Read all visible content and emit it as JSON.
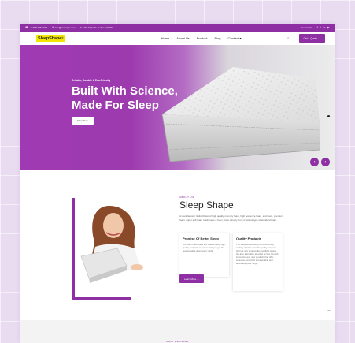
{
  "topbar": {
    "phone": "+1 008 456 0012",
    "email": "info@example.com",
    "address": "4297 Elgin St. Celina, 10299",
    "follow_label": "Follow Us"
  },
  "nav": {
    "logo": "SleepShape",
    "logo_mark": "®",
    "items": [
      "Home",
      "About Us",
      "Product",
      "Blog",
      "Contact"
    ],
    "cta": "Get A Quote"
  },
  "hero": {
    "kicker": "Reliable, Durable & Eco-Friendly",
    "title_line1": "Built With Science,",
    "title_line2": "Made For Sleep",
    "button": "Shop Now"
  },
  "about": {
    "label": "ABOUT US",
    "title": "Sleep Shape",
    "description": "A manufacturer & distributor of high quality memory foam, high resilience foam, and foam, premium foam, super soft foam mattresses & foam, foam directly from it various type of standard foam.",
    "card1_title": "Promise Of Better Sleep",
    "card1_text": "Our foam mattresses are crafted using high quality materials to ensure that you get the best possible sleep every night.",
    "card2_title": "Quality Products",
    "card2_text": "The sleep shape family is continuously making efforts to provide quality products that not only improve the healthful people, but also affordable sleeping across through innovation and new products that offer supreme comfort of a reasonable and affordable price range.",
    "button": "Learn More"
  },
  "offer": {
    "label": "WHAT WE OFFER"
  },
  "colors": {
    "brand": "#8e2fa3",
    "logo_bg": "#f2e600"
  }
}
